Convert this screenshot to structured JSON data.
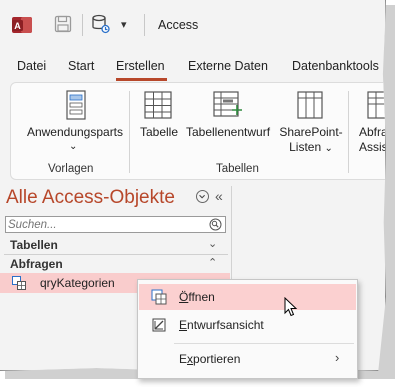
{
  "window": {
    "title": "Access"
  },
  "quick_access": {
    "more_icon": "chevron-down-icon"
  },
  "tabs": [
    "Datei",
    "Start",
    "Erstellen",
    "Externe Daten",
    "Datenbanktools"
  ],
  "active_tab": "Erstellen",
  "ribbon": {
    "groups": [
      {
        "label": "Vorlagen",
        "items": [
          {
            "label": "Anwendungsparts",
            "has_dropdown": true,
            "icon": "application-parts-icon"
          }
        ]
      },
      {
        "label": "Tabellen",
        "items": [
          {
            "label": "Tabelle",
            "icon": "table-icon"
          },
          {
            "label": "Tabellenentwurf",
            "icon": "table-design-icon"
          },
          {
            "label_line1": "SharePoint-",
            "label_line2": "Listen",
            "has_dropdown": true,
            "icon": "sharepoint-lists-icon"
          }
        ]
      },
      {
        "label": "",
        "items": [
          {
            "label_line1": "Abfra",
            "label_line2": "Assis",
            "icon": "query-wizard-icon"
          }
        ]
      }
    ]
  },
  "nav_pane": {
    "title": "Alle Access-Objekte",
    "search_placeholder": "Suchen...",
    "groups": [
      {
        "label": "Tabellen",
        "state": "collapsed"
      },
      {
        "label": "Abfragen",
        "state": "expanded"
      }
    ],
    "items": [
      {
        "label": "qryKategorien",
        "type": "query",
        "selected": true
      }
    ]
  },
  "context_menu": {
    "items": [
      {
        "label_pre": "",
        "accel": "Ö",
        "label_post": "ffnen",
        "icon": "open-icon",
        "hovered": true
      },
      {
        "label_pre": "",
        "accel": "E",
        "label_post": "ntwurfsansicht",
        "icon": "design-view-icon"
      },
      {
        "label_pre": "E",
        "accel": "x",
        "label_post": "portieren",
        "has_submenu": true
      }
    ]
  },
  "colors": {
    "accent": "#b7472a",
    "selection": "#f9cccc",
    "menu_hover": "#fbd0d0"
  }
}
